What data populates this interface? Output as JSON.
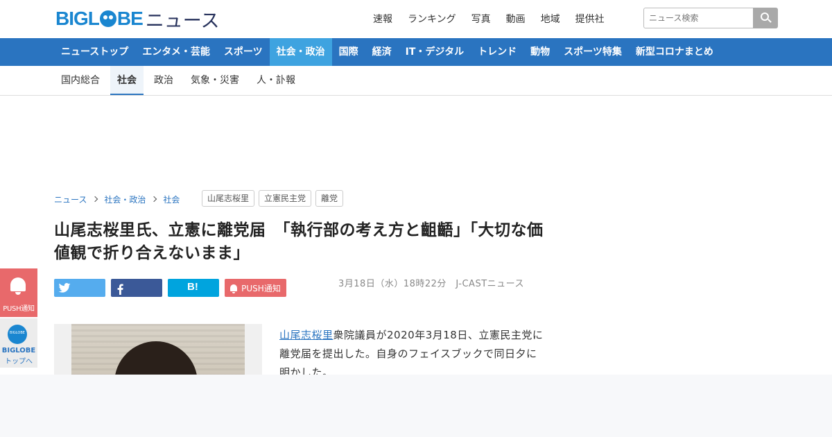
{
  "header": {
    "logo_biglobe_a": "BIGL",
    "logo_biglobe_b": "BE",
    "logo_news": "ニュース",
    "nav": [
      "速報",
      "ランキング",
      "写真",
      "動画",
      "地域",
      "提供社"
    ],
    "search_placeholder": "ニュース検索"
  },
  "categories": [
    "ニューストップ",
    "エンタメ・芸能",
    "スポーツ",
    "社会・政治",
    "国際",
    "経済",
    "IT・デジタル",
    "トレンド",
    "動物",
    "スポーツ特集",
    "新型コロナまとめ"
  ],
  "active_category": "社会・政治",
  "subcategories": [
    "国内総合",
    "社会",
    "政治",
    "気象・災害",
    "人・訃報"
  ],
  "active_subcategory": "社会",
  "breadcrumb": [
    "ニュース",
    "社会・政治",
    "社会"
  ],
  "tags": [
    "山尾志桜里",
    "立憲民主党",
    "離党"
  ],
  "article": {
    "title": "山尾志桜里氏、立憲に離党届　「執行部の考え方と齟齬」「大切な価値観で折り合えないまま」",
    "date": "3月18日（水）18時22分",
    "source": "J-CASTニュース",
    "body_link": "山尾志桜里",
    "body_text": "衆院議員が2020年3月18日、立憲民主党に離党届を提出した。自身のフェイスブックで同日夕に明かした。"
  },
  "share": {
    "hatena_label": "B!",
    "push_label": "PUSH通知"
  },
  "side": {
    "push_label": "PUSH通知",
    "top_ball_label": "BIGLOBE",
    "top_label_1": "BIGLOBE",
    "top_label_2": "トップへ"
  },
  "colors": {
    "brand_blue": "#1a86d0",
    "category_bar": "#2a74c0",
    "category_active": "#3ea3e0",
    "push_red": "#e8696b",
    "twitter": "#55acee",
    "facebook": "#3b5998",
    "hatena": "#00a4de"
  }
}
